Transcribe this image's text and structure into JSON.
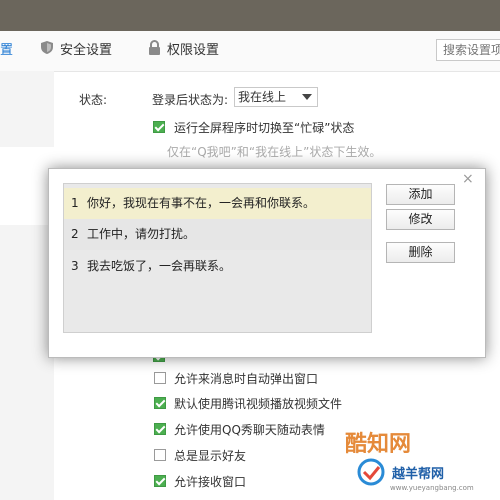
{
  "tabs": {
    "partial_label": "置",
    "security_label": "安全设置",
    "permission_label": "权限设置"
  },
  "search": {
    "placeholder": "搜索设置项"
  },
  "status": {
    "label": "状态:",
    "login_label": "登录后状态为:",
    "login_value": "我在线上",
    "fullscreen_option": "运行全屏程序时切换至“忙碌”状态",
    "hint": "仅在“Q我吧”和“我在线上”状态下生效。"
  },
  "dialog": {
    "close_symbol": "×",
    "replies": [
      {
        "number": "1",
        "text": "你好，我现在有事不在，一会再和你联系。"
      },
      {
        "number": "2",
        "text": "工作中，请勿打扰。"
      },
      {
        "number": "3",
        "text": "我去吃饭了，一会再联系。"
      }
    ],
    "add_label": "添加",
    "edit_label": "修改",
    "delete_label": "删除"
  },
  "options": [
    {
      "label": "允许来消息时自动弹出窗口",
      "checked": false
    },
    {
      "label": "默认使用腾讯视频播放视频文件",
      "checked": true
    },
    {
      "label": "允许使用QQ秀聊天随动表情",
      "checked": true
    },
    {
      "label": "总是显示好友",
      "checked": false
    },
    {
      "label": "允许接收窗口",
      "checked": true
    }
  ],
  "watermarks": {
    "kuzhi": "酷知网",
    "yueyang": "越羊帮网",
    "url": "www.yueyangbang.com"
  },
  "colors": {
    "accent": "#1b76d2",
    "check_green": "#4caf50",
    "selected_row": "#f3efce"
  }
}
